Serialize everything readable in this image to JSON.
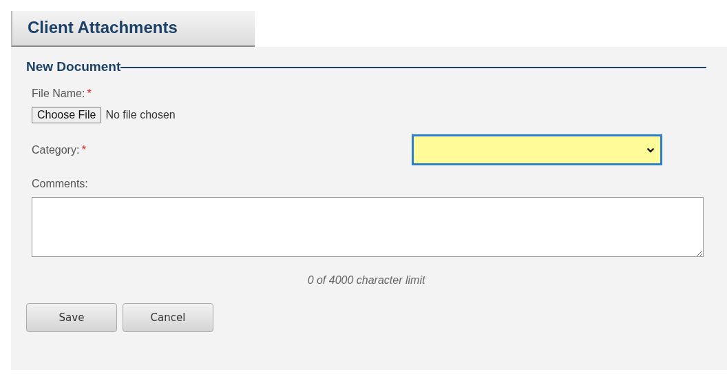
{
  "header": {
    "title": "Client Attachments"
  },
  "form": {
    "legend": "New Document",
    "fields": [
      {
        "kind": "file",
        "label": "File Name:",
        "required_mark": "*",
        "button": "Choose File",
        "status": "No file chosen"
      },
      {
        "kind": "select",
        "label": "Category:",
        "required_mark": "*"
      },
      {
        "kind": "textarea",
        "label": "Comments:",
        "counter": "0 of 4000 character limit"
      }
    ],
    "buttons": [
      "Save",
      "Cancel"
    ]
  }
}
